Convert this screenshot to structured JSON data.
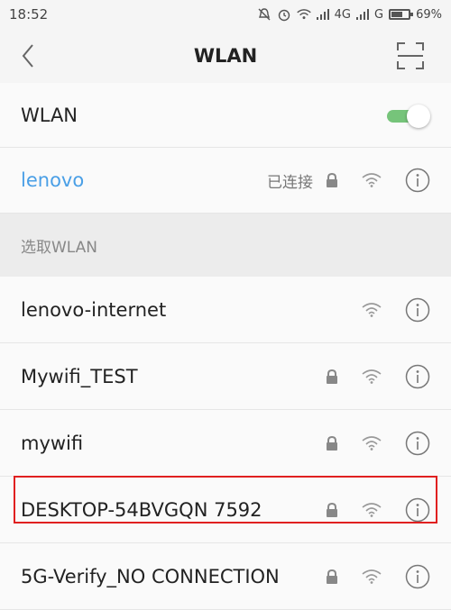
{
  "status_bar": {
    "time": "18:52",
    "network_1": "4G",
    "network_2": "G",
    "battery": "69%",
    "battery_level": 0.69
  },
  "header": {
    "title": "WLAN",
    "back_icon": "chevron-left-icon",
    "scan_icon": "scan-frame-icon"
  },
  "wlan_toggle": {
    "label": "WLAN",
    "enabled": true,
    "color": "#76c47a"
  },
  "connected_network": {
    "name": "lenovo",
    "status": "已连接",
    "secured": true,
    "color": "#4a9fe6"
  },
  "section": {
    "title": "选取WLAN"
  },
  "networks": [
    {
      "name": "lenovo-internet",
      "secured": false
    },
    {
      "name": "Mywifi_TEST",
      "secured": true
    },
    {
      "name": "mywifi",
      "secured": true
    },
    {
      "name": "DESKTOP-54BVGQN 7592",
      "secured": true,
      "highlighted": true
    },
    {
      "name": "5G-Verify_NO CONNECTION",
      "secured": true
    }
  ],
  "highlight_color": "#e02020"
}
